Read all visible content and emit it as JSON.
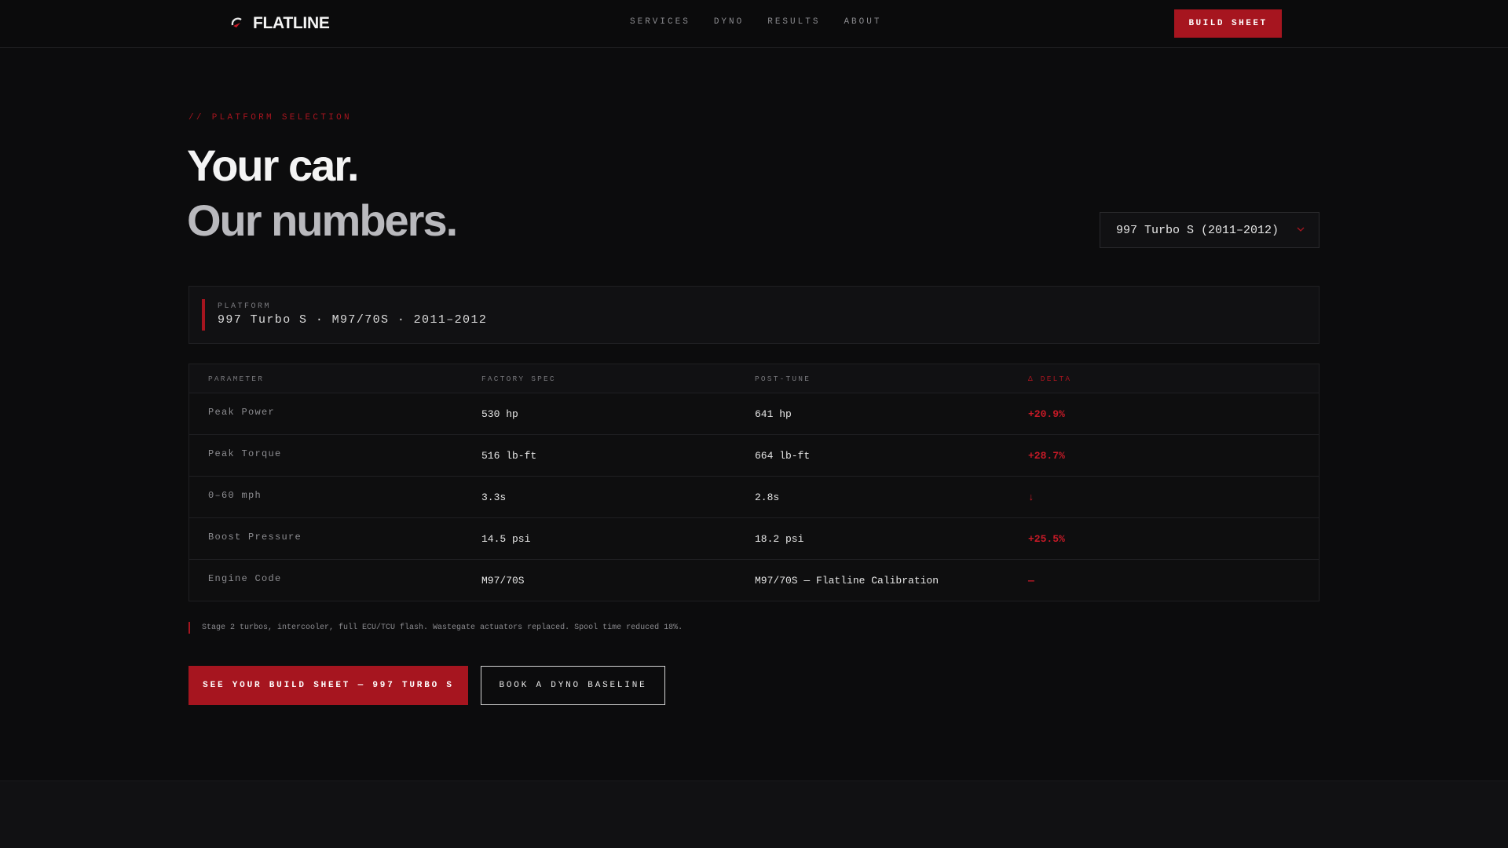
{
  "nav": {
    "brand": "FLATLINE",
    "links": [
      "SERVICES",
      "DYNO",
      "RESULTS",
      "ABOUT"
    ],
    "cta": "BUILD SHEET"
  },
  "hero": {
    "eyebrow": "// PLATFORM SELECTION",
    "title_line1": "Your car.",
    "title_line2": "Our numbers."
  },
  "selector": {
    "value": "997 Turbo S (2011–2012)"
  },
  "platform": {
    "label": "PLATFORM",
    "value": "997 Turbo S · M97/70S · 2011–2012"
  },
  "table": {
    "headers": [
      "PARAMETER",
      "FACTORY SPEC",
      "POST-TUNE",
      "Δ DELTA"
    ],
    "rows": [
      {
        "param": "Peak Power",
        "factory": "530 hp",
        "post": "641 hp",
        "delta": "+20.9%"
      },
      {
        "param": "Peak Torque",
        "factory": "516 lb-ft",
        "post": "664 lb-ft",
        "delta": "+28.7%"
      },
      {
        "param": "0–60 mph",
        "factory": "3.3s",
        "post": "2.8s",
        "delta": "↓"
      },
      {
        "param": "Boost Pressure",
        "factory": "14.5 psi",
        "post": "18.2 psi",
        "delta": "+25.5%"
      },
      {
        "param": "Engine Code",
        "factory": "M97/70S",
        "post": "M97/70S — Flatline Calibration",
        "delta": "—"
      }
    ]
  },
  "note": "Stage 2 turbos, intercooler, full ECU/TCU flash. Wastegate actuators replaced. Spool time reduced 18%.",
  "ctas": {
    "primary": "SEE YOUR BUILD SHEET — 997 TURBO S",
    "secondary": "BOOK A DYNO BASELINE"
  },
  "colors": {
    "accent": "#a6151f",
    "background": "#0c0c0d"
  }
}
